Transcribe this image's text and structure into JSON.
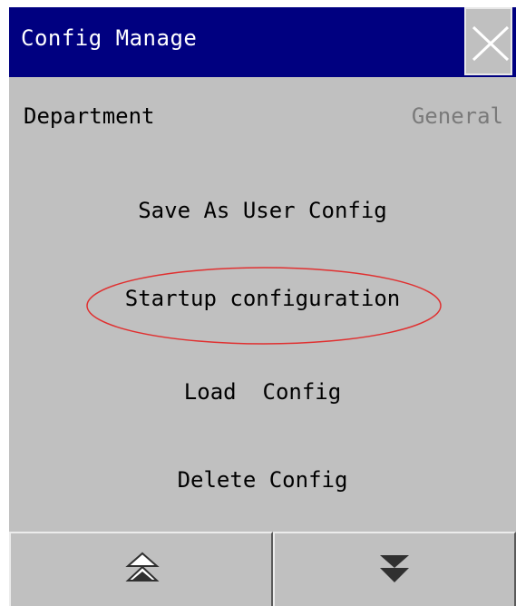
{
  "dialog": {
    "title": "Config Manage",
    "close_icon": "close-icon"
  },
  "department": {
    "label": "Department",
    "value": "General"
  },
  "menu": {
    "save_as_user_config": "Save As User Config",
    "startup_configuration": "Startup configuration",
    "load_config": "Load  Config",
    "delete_config": "Delete Config"
  },
  "navigation": {
    "page_up_icon": "double-chevron-up-icon",
    "page_down_icon": "double-chevron-down-icon"
  },
  "colors": {
    "titlebar": "#000080",
    "panel": "#c0c0c0",
    "highlight_ellipse": "#e03030",
    "value_text": "#7a7a7a"
  }
}
